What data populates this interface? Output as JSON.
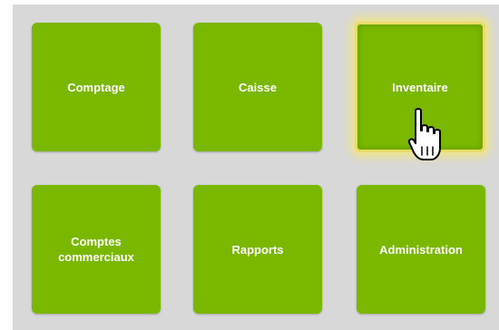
{
  "tiles": [
    {
      "id": "comptage",
      "label": "Comptage"
    },
    {
      "id": "caisse",
      "label": "Caisse"
    },
    {
      "id": "inventaire",
      "label": "Inventaire",
      "active": true
    },
    {
      "id": "comptes-commerciaux",
      "label": "Comptes\ncommerciaux"
    },
    {
      "id": "rapports",
      "label": "Rapports"
    },
    {
      "id": "administration",
      "label": "Administration"
    }
  ],
  "colors": {
    "background": "#d8d8d8",
    "tile": "#7ab800",
    "tile_text": "#ffffff",
    "highlight": "#f4e678"
  },
  "cursor": {
    "icon": "hand-pointer-icon"
  }
}
